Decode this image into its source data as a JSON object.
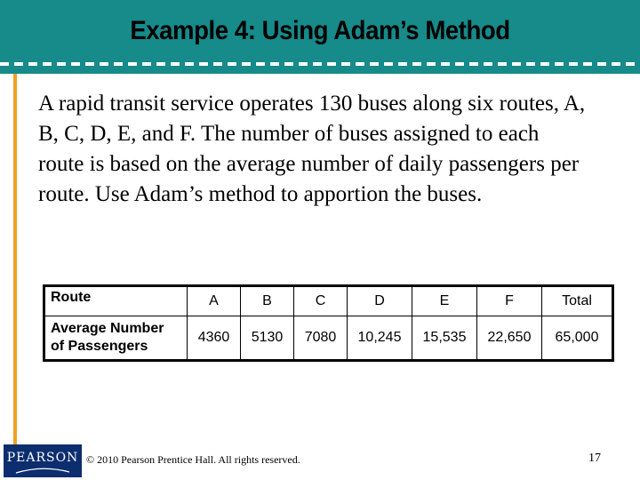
{
  "slide": {
    "title": "Example 4: Using Adam’s Method",
    "body": "A rapid transit service operates 130 buses along six routes, A, B, C, D, E, and F. The number of buses assigned to each route is based on the average number of daily passengers per route. Use Adam’s method to apportion the buses.",
    "colors": {
      "header_band": "#178a8a",
      "dash_line": "#ffffff",
      "accent_rule": "#f0a020",
      "logo_bg": "#0c2d6e"
    }
  },
  "table": {
    "rows": [
      {
        "label": "Route",
        "cells": [
          "A",
          "B",
          "C",
          "D",
          "E",
          "F",
          "Total"
        ]
      },
      {
        "label_line1": "Average Number",
        "label_line2": "of Passengers",
        "cells": [
          "4360",
          "5130",
          "7080",
          "10,245",
          "15,535",
          "22,650",
          "65,000"
        ]
      }
    ]
  },
  "footer": {
    "logo_text": "PEARSON",
    "copyright": "© 2010 Pearson Prentice Hall. All rights reserved.",
    "page_number": "17"
  }
}
